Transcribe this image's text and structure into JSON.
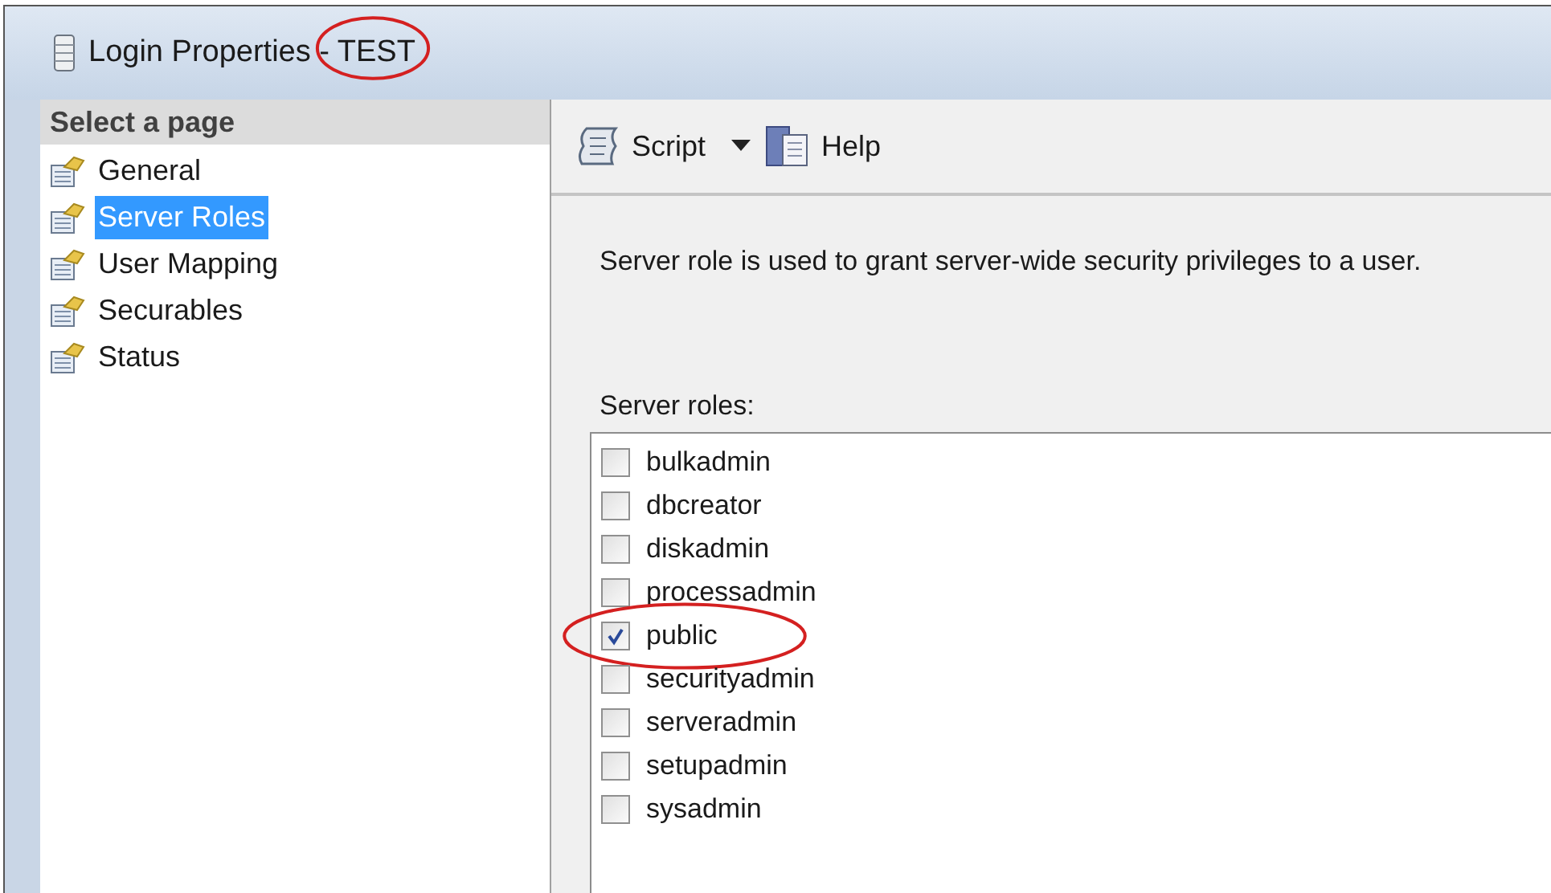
{
  "window": {
    "title": "Login Properties - TEST",
    "title_highlighted": true
  },
  "sidebar": {
    "header": "Select a page",
    "items": [
      {
        "label": "General",
        "selected": false
      },
      {
        "label": "Server Roles",
        "selected": true
      },
      {
        "label": "User Mapping",
        "selected": false
      },
      {
        "label": "Securables",
        "selected": false
      },
      {
        "label": "Status",
        "selected": false
      }
    ]
  },
  "toolbar": {
    "script": "Script",
    "help": "Help"
  },
  "description": "Server role is used to grant server-wide security privileges to a user.",
  "roles_label": "Server roles:",
  "roles": [
    {
      "label": "bulkadmin",
      "checked": false,
      "highlighted": false
    },
    {
      "label": "dbcreator",
      "checked": false,
      "highlighted": false
    },
    {
      "label": "diskadmin",
      "checked": false,
      "highlighted": false
    },
    {
      "label": "processadmin",
      "checked": false,
      "highlighted": false
    },
    {
      "label": "public",
      "checked": true,
      "highlighted": true
    },
    {
      "label": "securityadmin",
      "checked": false,
      "highlighted": false
    },
    {
      "label": "serveradmin",
      "checked": false,
      "highlighted": false
    },
    {
      "label": "setupadmin",
      "checked": false,
      "highlighted": false
    },
    {
      "label": "sysadmin",
      "checked": false,
      "highlighted": false
    }
  ]
}
